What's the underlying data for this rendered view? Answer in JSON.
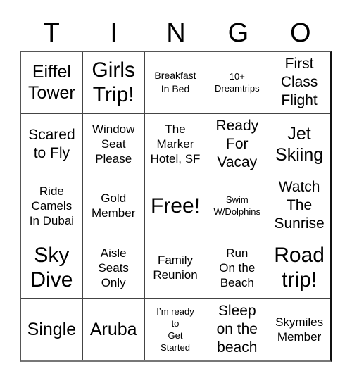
{
  "card": {
    "header_letters": [
      "T",
      "I",
      "N",
      "G",
      "O"
    ],
    "cells": [
      {
        "text": "Eiffel\nTower",
        "size": "fs-l"
      },
      {
        "text": "Girls\nTrip!",
        "size": "fs-xl"
      },
      {
        "text": "Breakfast\nIn Bed",
        "size": "fs-xs"
      },
      {
        "text": "10+\nDreamtrips",
        "size": "fs-xxs"
      },
      {
        "text": "First\nClass\nFlight",
        "size": "fs-ml"
      },
      {
        "text": "Scared\nto Fly",
        "size": "fs-ml"
      },
      {
        "text": "Window\nSeat\nPlease",
        "size": "fs-s"
      },
      {
        "text": "The\nMarker\nHotel, SF",
        "size": "fs-s"
      },
      {
        "text": "Ready\nFor\nVacay",
        "size": "fs-ml"
      },
      {
        "text": "Jet\nSkiing",
        "size": "fs-l"
      },
      {
        "text": "Ride\nCamels\nIn Dubai",
        "size": "fs-s"
      },
      {
        "text": "Gold\nMember",
        "size": "fs-s"
      },
      {
        "text": "Free!",
        "size": "fs-xl"
      },
      {
        "text": "Swim\nW/Dolphins",
        "size": "fs-xxs"
      },
      {
        "text": "Watch\nThe\nSunrise",
        "size": "fs-ml"
      },
      {
        "text": "Sky\nDive",
        "size": "fs-xl"
      },
      {
        "text": "Aisle\nSeats\nOnly",
        "size": "fs-s"
      },
      {
        "text": "Family\nReunion",
        "size": "fs-s"
      },
      {
        "text": "Run\nOn the\nBeach",
        "size": "fs-s"
      },
      {
        "text": "Road\ntrip!",
        "size": "fs-xl"
      },
      {
        "text": "Single",
        "size": "fs-l"
      },
      {
        "text": "Aruba",
        "size": "fs-l"
      },
      {
        "text": "I’m ready\nto\nGet\nStarted",
        "size": "fs-xxs"
      },
      {
        "text": "Sleep\non the\nbeach",
        "size": "fs-ml"
      },
      {
        "text": "Skymiles\nMember",
        "size": "fs-s"
      }
    ]
  }
}
